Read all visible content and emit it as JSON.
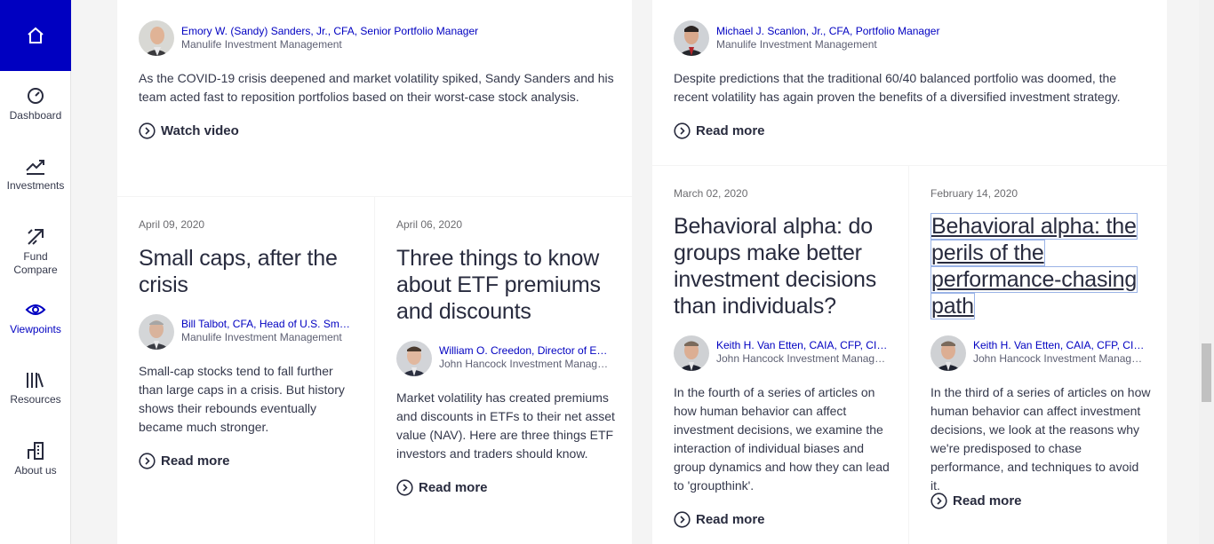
{
  "sidebar": {
    "home_icon": "home-icon",
    "items": [
      {
        "label": "Dashboard",
        "icon": "gauge-icon"
      },
      {
        "label": "Investments",
        "icon": "trend-icon"
      },
      {
        "label": "Fund Compare",
        "icon": "compare-icon"
      },
      {
        "label": "Viewpoints",
        "icon": "eye-icon"
      },
      {
        "label": "Resources",
        "icon": "books-icon"
      },
      {
        "label": "About us",
        "icon": "building-icon"
      }
    ],
    "active_color": "#0000c1"
  },
  "cards": [
    {
      "author_name": "Emory W. (Sandy) Sanders, Jr., CFA, Senior Portfolio Manager",
      "author_org": "Manulife Investment Management",
      "body": "As the COVID-19 crisis deepened and market volatility spiked, Sandy Sanders and his team acted fast to reposition portfolios based on their worst-case stock analysis.",
      "cta": "Watch video"
    },
    {
      "author_name": "Michael J. Scanlon, Jr., CFA, Portfolio Manager",
      "author_org": "Manulife Investment Management",
      "body": "Despite predictions that the traditional 60/40 balanced portfolio was doomed, the recent volatility has again proven the benefits of a diversified investment strategy.",
      "cta": "Read more"
    },
    {
      "date": "April 09, 2020",
      "title": "Small caps, after the crisis",
      "author_name": "Bill Talbot, CFA, Head of U.S. Small ...",
      "author_org": "Manulife Investment Management",
      "body": "Small-cap stocks tend to fall further than large caps in a crisis. But history shows their rebounds eventually became much stronger.",
      "cta": "Read more"
    },
    {
      "date": "April 06, 2020",
      "title": "Three things to know about ETF premiums and discounts",
      "author_name": "William O. Creedon, Director of ETF ...",
      "author_org": "John Hancock Investment Managem...",
      "body": "Market volatility has created premiums and discounts in ETFs to their net asset value (NAV). Here are three things ETF investors and traders should know.",
      "cta": "Read more"
    },
    {
      "date": "March 02, 2020",
      "title": "Behavioral alpha: do groups make better investment decisions than individuals?",
      "author_name": "Keith H. Van Etten, CAIA, CFP, CIMA,...",
      "author_org": "John Hancock Investment Managem...",
      "body": "In the fourth of a series of articles on how human behavior can affect investment decisions, we examine the interaction of individual biases and group dynamics and how they can lead to 'groupthink'.",
      "cta": "Read more"
    },
    {
      "date": "February 14, 2020",
      "title_lines": [
        "Behavioral alpha: the",
        "perils of the",
        "performance-chasing",
        "path"
      ],
      "author_name": "Keith H. Van Etten, CAIA, CFP, CIMA, ...",
      "author_org": "John Hancock Investment Managem...",
      "body": "In the third of a series of articles on how human behavior can affect investment decisions, we look at the reasons why we're predisposed to chase performance, and techniques to avoid it.",
      "cta": "Read more"
    }
  ]
}
